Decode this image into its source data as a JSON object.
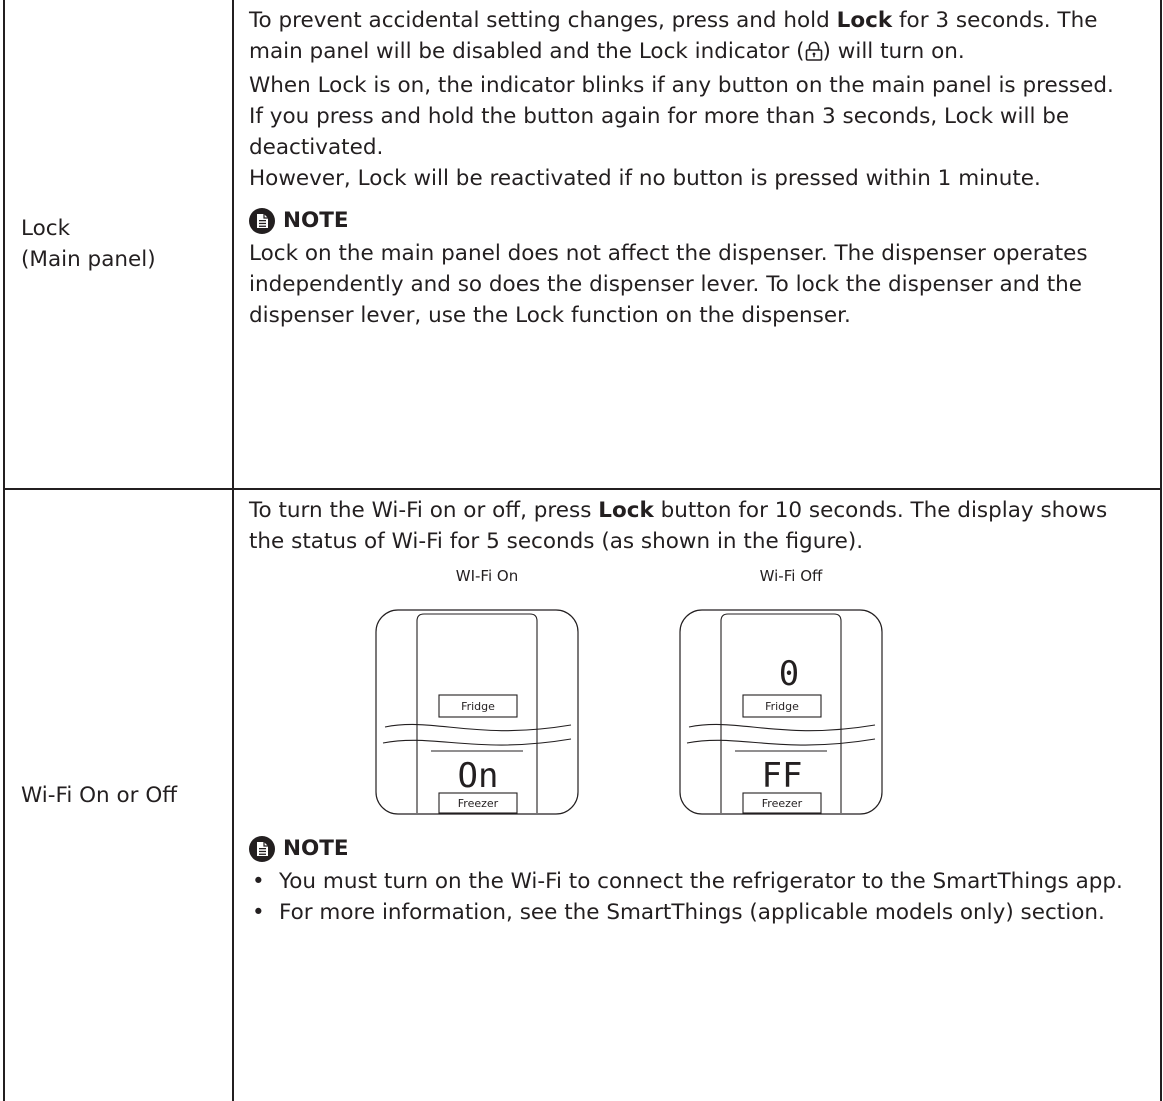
{
  "rows": [
    {
      "label": "Lock",
      "sublabel": "(Main panel)",
      "p1_a": "To prevent accidental setting changes, press and hold ",
      "p1_b": "Lock",
      "p1_c": " for 3 seconds. The main panel will be disabled and the Lock indicator (",
      "p1_d": ") will turn on.",
      "p2": "When Lock is on, the indicator blinks if any button on the main panel is pressed.",
      "p3": "If you press and hold the button again for more than 3 seconds, Lock will be deactivated.",
      "p4": "However, Lock will be reactivated if no button is pressed within 1 minute.",
      "note_title": "NOTE",
      "note_text": "Lock on the main panel does not affect the dispenser. The dispenser operates independently and so does the dispenser lever. To lock the dispenser and the dispenser lever, use the Lock function on the dispenser.",
      "lock_icon": "lock-icon"
    },
    {
      "label": "Wi-Fi On or Off",
      "p1_a": "To turn the Wi-Fi on or off, press ",
      "p1_b": "Lock",
      "p1_c": " button for 10 seconds. The display shows the status of Wi-Fi for 5 seconds (as shown in the figure).",
      "figures": [
        {
          "caption": "WI-Fi On",
          "top_digit": "",
          "fridge": "Fridge",
          "bottom_digits": "On",
          "freezer": "Freezer"
        },
        {
          "caption": "Wi-Fi Off",
          "top_digit": "0",
          "fridge": "Fridge",
          "bottom_digits": "FF",
          "freezer": "Freezer"
        }
      ],
      "note_title": "NOTE",
      "bullets": [
        "You must turn on the Wi-Fi to connect the refrigerator to the SmartThings app.",
        "For more information, see the SmartThings (applicable models only) section."
      ],
      "note_icon": "note-icon"
    }
  ]
}
